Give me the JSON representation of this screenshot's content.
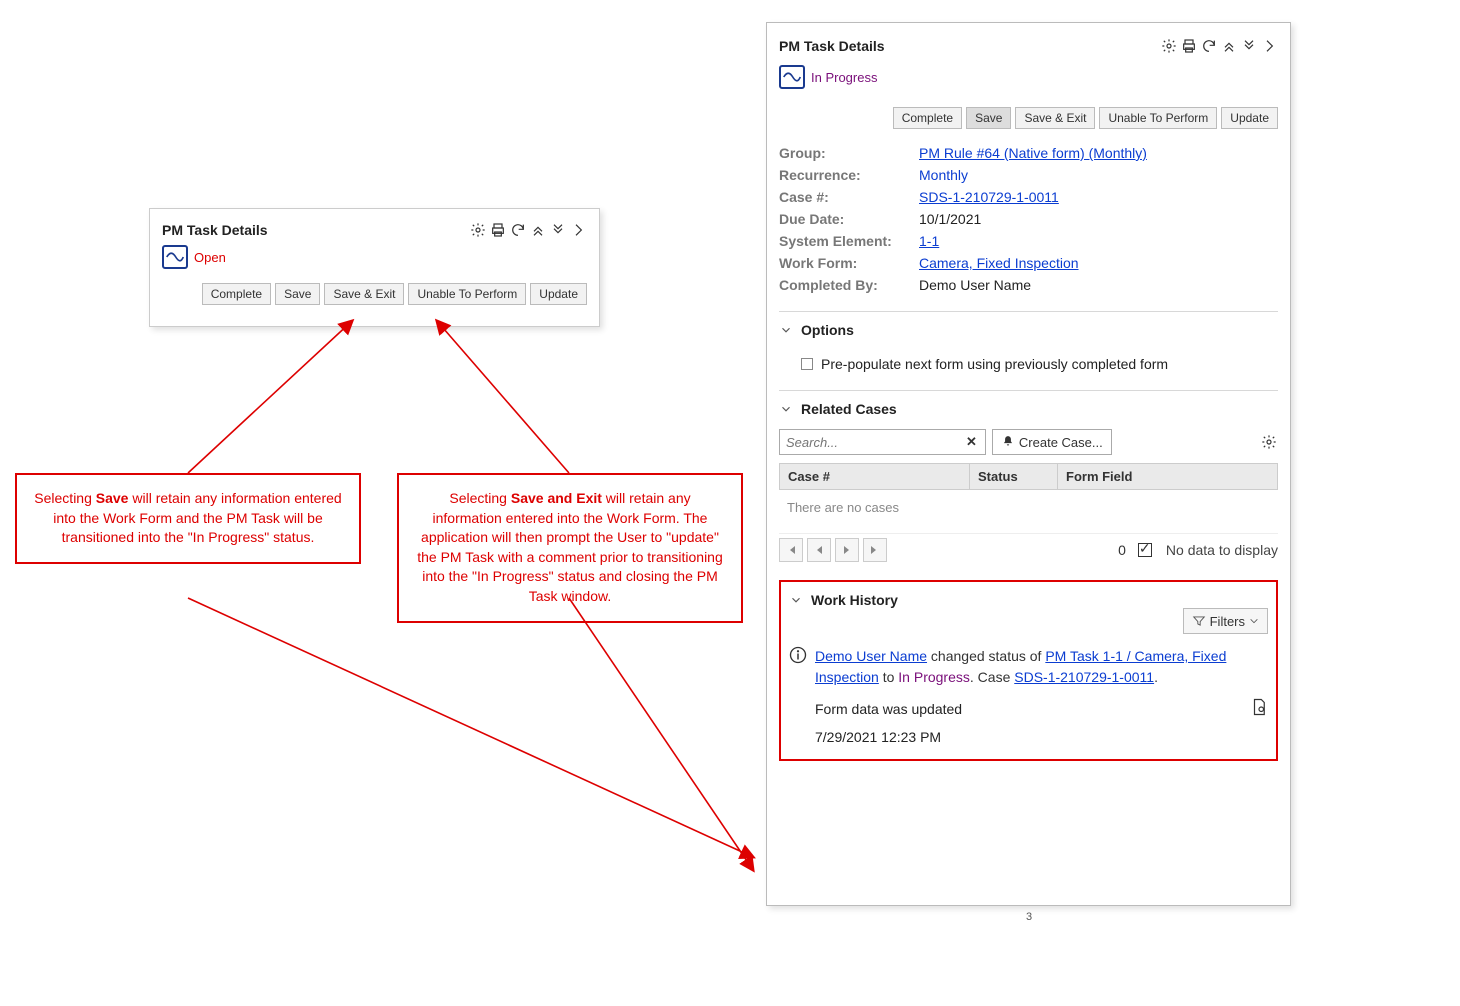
{
  "small_panel": {
    "title": "PM Task Details",
    "status": "Open",
    "buttons": {
      "complete": "Complete",
      "save": "Save",
      "save_exit": "Save & Exit",
      "unable": "Unable To Perform",
      "update": "Update"
    }
  },
  "callouts": {
    "a_pre": "Selecting ",
    "a_bold": "Save",
    "a_post": " will retain any information entered into the Work Form and the PM Task will be transitioned into the \"In Progress\" status.",
    "b_pre": "Selecting ",
    "b_bold": "Save and Exit",
    "b_post": "  will retain any information entered into the Work Form. The application will then prompt the User to \"update\" the PM Task with a comment prior to transitioning into the \"In Progress\" status and closing the PM Task window."
  },
  "big_panel": {
    "title": "PM Task Details",
    "status": "In Progress",
    "buttons": {
      "complete": "Complete",
      "save": "Save",
      "save_exit": "Save & Exit",
      "unable": "Unable To Perform",
      "update": "Update"
    },
    "details": {
      "group_label": "Group:",
      "group_val": "PM Rule #64 (Native form) (Monthly)",
      "recurrence_label": "Recurrence:",
      "recurrence_val": "Monthly",
      "case_label": "Case #:",
      "case_val": "SDS-1-210729-1-0011",
      "due_label": "Due Date:",
      "due_val": "10/1/2021",
      "sysel_label": "System Element:",
      "sysel_val": "1-1",
      "wf_label": "Work Form:",
      "wf_val": "Camera, Fixed Inspection",
      "comp_label": "Completed By:",
      "comp_val": "Demo User Name"
    },
    "options_title": "Options",
    "prepop_label": "Pre-populate next form using previously completed form",
    "related_title": "Related Cases",
    "search_placeholder": "Search...",
    "create_case_label": "Create Case...",
    "col_case": "Case #",
    "col_status": "Status",
    "col_ff": "Form Field",
    "no_cases": "There are no cases",
    "page_count": "0",
    "no_data": "No data to display",
    "wh_title": "Work History",
    "filters_label": "Filters",
    "wh": {
      "user": "Demo User Name",
      "mid": " changed status of ",
      "task_link": "PM Task 1-1 / Camera, Fixed Inspection",
      "to": " to ",
      "status_word": "In Progress",
      "dot_case": ". Case ",
      "case_link": "SDS-1-210729-1-0011",
      "tail": ".",
      "sub": "Form data was updated",
      "time": "7/29/2021 12:23 PM"
    }
  },
  "page_number": "3"
}
